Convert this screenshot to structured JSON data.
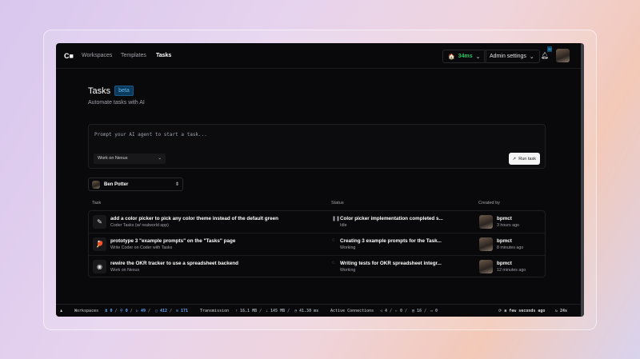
{
  "nav": {
    "logo": "C■",
    "links": [
      "Workspaces",
      "Templates",
      "Tasks"
    ],
    "latency": "34ms",
    "admin": "Admin settings",
    "notif_badge": "32"
  },
  "header": {
    "title": "Tasks",
    "badge": "beta",
    "subtitle": "Automate tasks with AI"
  },
  "prompt": {
    "placeholder": "Prompt your AI agent to start a task...",
    "template": "Work on Nexus",
    "run": "Run task"
  },
  "user_filter": "Ben Potter",
  "table": {
    "headers": [
      "Task",
      "Status",
      "Created by"
    ],
    "rows": [
      {
        "icon": "✎",
        "name": "add a color picker to pick any color theme instead of the default green",
        "template": "Coder Tasks (w/ realworld app)",
        "status_icon": "pause",
        "status": "Color picker implementation completed s...",
        "state": "Idle",
        "user": "bpmct",
        "time": "3 hours ago"
      },
      {
        "icon": "🏓",
        "name": "prototype 3 \"example prompts\" on the \"Tasks\" page",
        "template": "Write Coder on Coder with Tasks",
        "status_icon": "spinner",
        "status": "Creating 3 example prompts for the Task...",
        "state": "Working",
        "user": "bpmct",
        "time": "8 minutes ago"
      },
      {
        "icon": "◉",
        "name": "rewire the OKR tracker to use a spreadsheet backend",
        "template": "Work on Nexus",
        "status_icon": "spinner",
        "status": "Writing tests for OKR spreadsheet integr...",
        "state": "Working",
        "user": "bpmct",
        "time": "12 minutes ago"
      }
    ]
  },
  "footer": {
    "workspaces": "Workspaces",
    "ws_counts": [
      "0",
      "0",
      "49",
      "412",
      "171"
    ],
    "transmission": "Transmission",
    "tx": [
      "16.1 MB",
      "145 MB",
      "41.30 ms"
    ],
    "active": "Active Connections",
    "conn": [
      "4",
      "0",
      "16",
      "0"
    ],
    "updated": "a few seconds ago",
    "refresh": "24s"
  }
}
